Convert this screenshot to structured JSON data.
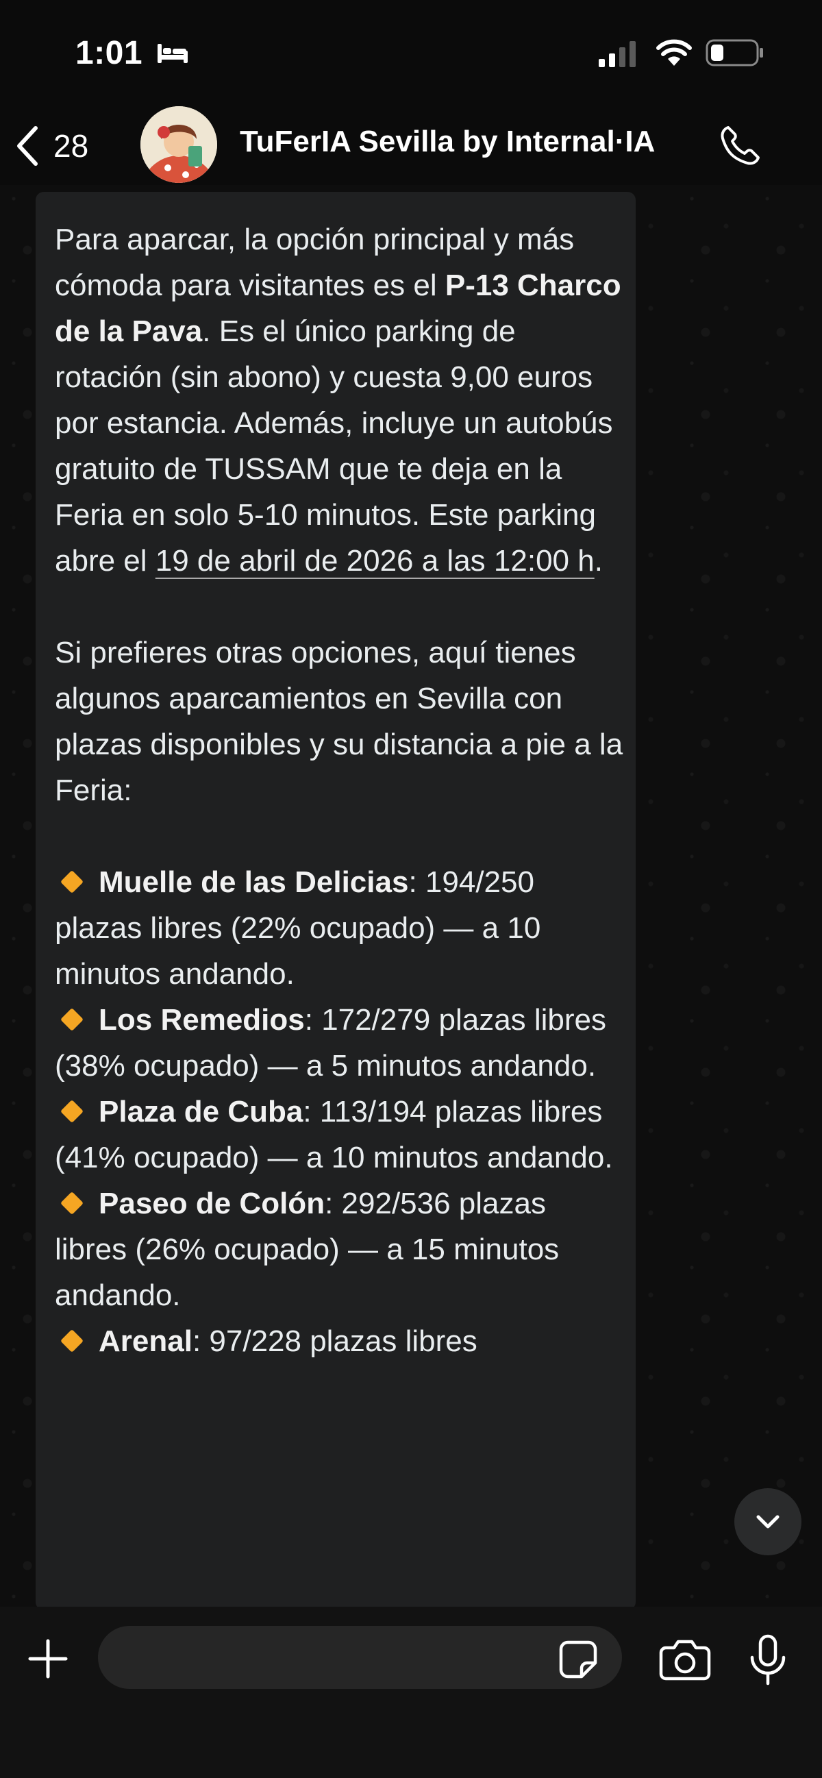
{
  "status_bar": {
    "time": "1:01",
    "icons": [
      "bed-icon",
      "signal-icon",
      "wifi-icon",
      "battery-icon"
    ]
  },
  "header": {
    "back_count": "28",
    "title": "TuFerIA Sevilla by Internal·IA",
    "icons": [
      "back-chevron-icon",
      "avatar",
      "phone-icon"
    ]
  },
  "message": {
    "intro": {
      "part1": "Para aparcar, la opción principal y más cómoda para visitantes es el ",
      "bold": "P-13 Charco de la Pava",
      "part2": ". Es el único parking de rotación (sin abono) y cuesta 9,00 euros por estancia. Además, incluye un autobús gratuito de TUSSAM que te deja en la Feria en solo 5-10 minutos. Este parking abre el ",
      "date_link": "19 de abril de 2026 a las 12:00 h",
      "end": "."
    },
    "other_options": "Si prefieres otras opciones, aquí tienes algunos aparcamientos en Sevilla con plazas disponibles y su distancia a pie a la Feria:",
    "parkings": [
      {
        "name": "Muelle de las Delicias",
        "detail": ": 194/250 plazas libres (22% ocupado) — a 10 minutos andando."
      },
      {
        "name": "Los Remedios",
        "detail": ": 172/279 plazas libres (38% ocupado) — a 5 minutos andando."
      },
      {
        "name": "Plaza de Cuba",
        "detail": ": 113/194 plazas libres (41% ocupado) — a 10 minutos andando."
      },
      {
        "name": "Paseo de Colón",
        "detail": ": 292/536 plazas libres (26% ocupado) — a 15 minutos andando."
      },
      {
        "name": "Arenal",
        "detail": ": 97/228 plazas libres"
      }
    ],
    "bullet_icon": "orange-diamond-icon"
  },
  "input_bar": {
    "placeholder": "",
    "icons": [
      "plus-icon",
      "sticker-icon",
      "camera-icon",
      "mic-icon"
    ]
  },
  "scroll_button_icon": "chevron-down-icon",
  "colors": {
    "background": "#0b0b0b",
    "bubble": "#1f2021",
    "text": "#e9edef",
    "bullet": "#f5a623"
  }
}
